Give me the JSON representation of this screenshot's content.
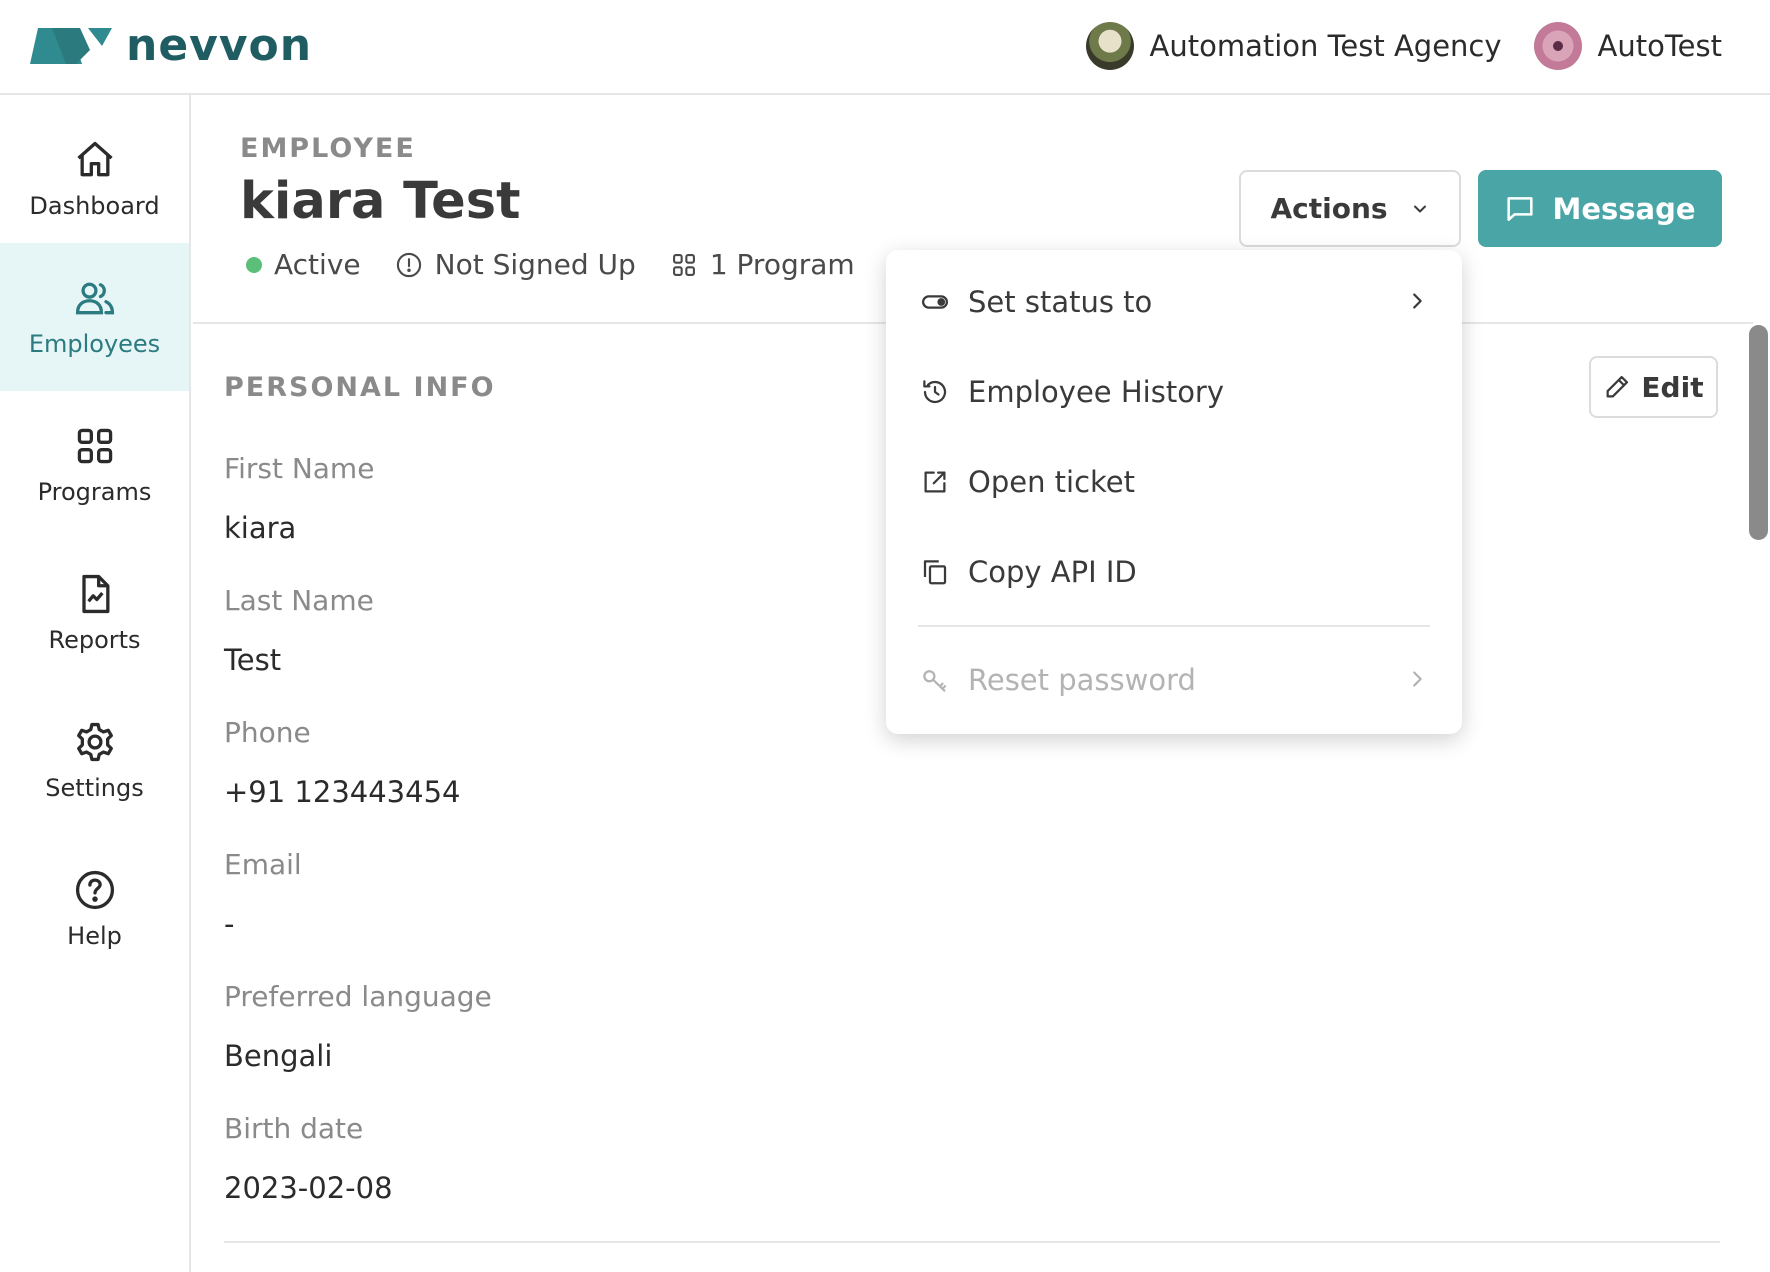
{
  "header": {
    "logo_text": "nevvon",
    "agency_name": "Automation Test Agency",
    "user_name": "AutoTest"
  },
  "sidebar": {
    "items": [
      {
        "label": "Dashboard",
        "icon": "home-icon"
      },
      {
        "label": "Employees",
        "icon": "users-icon",
        "active": true
      },
      {
        "label": "Programs",
        "icon": "grid-icon"
      },
      {
        "label": "Reports",
        "icon": "report-icon"
      },
      {
        "label": "Settings",
        "icon": "gear-icon"
      },
      {
        "label": "Help",
        "icon": "help-icon"
      }
    ]
  },
  "page": {
    "eyebrow": "EMPLOYEE",
    "title": "kiara Test",
    "status": {
      "active": "Active",
      "signup": "Not Signed Up",
      "programs": "1 Program"
    },
    "actions_label": "Actions",
    "message_label": "Message"
  },
  "personal_info": {
    "section_title": "PERSONAL INFO",
    "edit_label": "Edit",
    "fields": [
      {
        "label": "First Name",
        "value": "kiara"
      },
      {
        "label": "Last Name",
        "value": "Test"
      },
      {
        "label": "Phone",
        "value": "+91 123443454"
      },
      {
        "label": "Email",
        "value": "-"
      },
      {
        "label": "Preferred language",
        "value": "Bengali"
      },
      {
        "label": "Birth date",
        "value": "2023-02-08"
      }
    ]
  },
  "actions_menu": {
    "items": [
      {
        "label": "Set status to",
        "icon": "toggle-icon",
        "has_submenu": true
      },
      {
        "label": "Employee History",
        "icon": "history-icon"
      },
      {
        "label": "Open ticket",
        "icon": "external-link-icon"
      },
      {
        "label": "Copy API ID",
        "icon": "copy-icon"
      },
      {
        "label": "Reset password",
        "icon": "key-icon",
        "has_submenu": true,
        "disabled": true
      }
    ]
  },
  "colors": {
    "brand": "#1f5d63",
    "accent": "#4aa6a6",
    "active_nav_bg": "#e6f5f5",
    "status_active": "#5bbf7a"
  }
}
